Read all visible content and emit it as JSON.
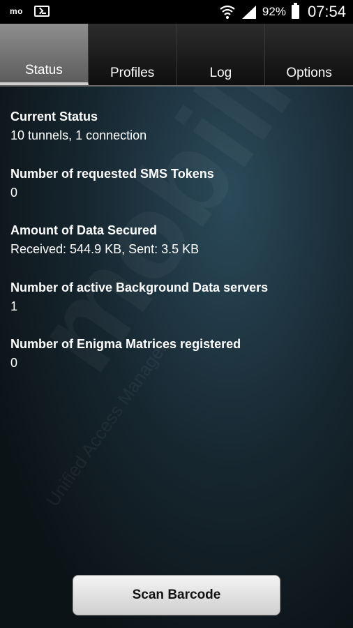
{
  "status_bar": {
    "left_label": "mo",
    "battery_percent": "92%",
    "time": "07:54",
    "icons": [
      "terminal-icon",
      "wifi-icon",
      "signal-icon",
      "battery-icon"
    ]
  },
  "tabs": [
    {
      "label": "Status",
      "active": true
    },
    {
      "label": "Profiles",
      "active": false
    },
    {
      "label": "Log",
      "active": false
    },
    {
      "label": "Options",
      "active": false
    }
  ],
  "watermark": {
    "text": "mobility",
    "subtext": "Unified Access Manager"
  },
  "status_items": [
    {
      "title": "Current Status",
      "value": "10 tunnels, 1 connection"
    },
    {
      "title": "Number of requested SMS Tokens",
      "value": "0"
    },
    {
      "title": "Amount of Data Secured",
      "value": "Received: 544.9 KB, Sent: 3.5 KB"
    },
    {
      "title": "Number of active Background Data servers",
      "value": "1"
    },
    {
      "title": "Number of Enigma Matrices registered",
      "value": "0"
    }
  ],
  "scan_button": {
    "label": "Scan Barcode"
  },
  "colors": {
    "accent_tab": "#7a7a7a",
    "background": "#16262f",
    "text": "#ffffff"
  }
}
